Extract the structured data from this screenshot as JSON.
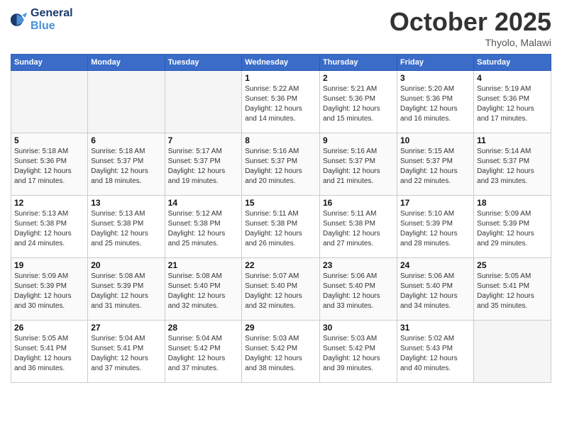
{
  "header": {
    "logo_line1": "General",
    "logo_line2": "Blue",
    "month": "October 2025",
    "location": "Thyolo, Malawi"
  },
  "weekdays": [
    "Sunday",
    "Monday",
    "Tuesday",
    "Wednesday",
    "Thursday",
    "Friday",
    "Saturday"
  ],
  "weeks": [
    [
      {
        "day": "",
        "info": ""
      },
      {
        "day": "",
        "info": ""
      },
      {
        "day": "",
        "info": ""
      },
      {
        "day": "1",
        "info": "Sunrise: 5:22 AM\nSunset: 5:36 PM\nDaylight: 12 hours\nand 14 minutes."
      },
      {
        "day": "2",
        "info": "Sunrise: 5:21 AM\nSunset: 5:36 PM\nDaylight: 12 hours\nand 15 minutes."
      },
      {
        "day": "3",
        "info": "Sunrise: 5:20 AM\nSunset: 5:36 PM\nDaylight: 12 hours\nand 16 minutes."
      },
      {
        "day": "4",
        "info": "Sunrise: 5:19 AM\nSunset: 5:36 PM\nDaylight: 12 hours\nand 17 minutes."
      }
    ],
    [
      {
        "day": "5",
        "info": "Sunrise: 5:18 AM\nSunset: 5:36 PM\nDaylight: 12 hours\nand 17 minutes."
      },
      {
        "day": "6",
        "info": "Sunrise: 5:18 AM\nSunset: 5:37 PM\nDaylight: 12 hours\nand 18 minutes."
      },
      {
        "day": "7",
        "info": "Sunrise: 5:17 AM\nSunset: 5:37 PM\nDaylight: 12 hours\nand 19 minutes."
      },
      {
        "day": "8",
        "info": "Sunrise: 5:16 AM\nSunset: 5:37 PM\nDaylight: 12 hours\nand 20 minutes."
      },
      {
        "day": "9",
        "info": "Sunrise: 5:16 AM\nSunset: 5:37 PM\nDaylight: 12 hours\nand 21 minutes."
      },
      {
        "day": "10",
        "info": "Sunrise: 5:15 AM\nSunset: 5:37 PM\nDaylight: 12 hours\nand 22 minutes."
      },
      {
        "day": "11",
        "info": "Sunrise: 5:14 AM\nSunset: 5:37 PM\nDaylight: 12 hours\nand 23 minutes."
      }
    ],
    [
      {
        "day": "12",
        "info": "Sunrise: 5:13 AM\nSunset: 5:38 PM\nDaylight: 12 hours\nand 24 minutes."
      },
      {
        "day": "13",
        "info": "Sunrise: 5:13 AM\nSunset: 5:38 PM\nDaylight: 12 hours\nand 25 minutes."
      },
      {
        "day": "14",
        "info": "Sunrise: 5:12 AM\nSunset: 5:38 PM\nDaylight: 12 hours\nand 25 minutes."
      },
      {
        "day": "15",
        "info": "Sunrise: 5:11 AM\nSunset: 5:38 PM\nDaylight: 12 hours\nand 26 minutes."
      },
      {
        "day": "16",
        "info": "Sunrise: 5:11 AM\nSunset: 5:38 PM\nDaylight: 12 hours\nand 27 minutes."
      },
      {
        "day": "17",
        "info": "Sunrise: 5:10 AM\nSunset: 5:39 PM\nDaylight: 12 hours\nand 28 minutes."
      },
      {
        "day": "18",
        "info": "Sunrise: 5:09 AM\nSunset: 5:39 PM\nDaylight: 12 hours\nand 29 minutes."
      }
    ],
    [
      {
        "day": "19",
        "info": "Sunrise: 5:09 AM\nSunset: 5:39 PM\nDaylight: 12 hours\nand 30 minutes."
      },
      {
        "day": "20",
        "info": "Sunrise: 5:08 AM\nSunset: 5:39 PM\nDaylight: 12 hours\nand 31 minutes."
      },
      {
        "day": "21",
        "info": "Sunrise: 5:08 AM\nSunset: 5:40 PM\nDaylight: 12 hours\nand 32 minutes."
      },
      {
        "day": "22",
        "info": "Sunrise: 5:07 AM\nSunset: 5:40 PM\nDaylight: 12 hours\nand 32 minutes."
      },
      {
        "day": "23",
        "info": "Sunrise: 5:06 AM\nSunset: 5:40 PM\nDaylight: 12 hours\nand 33 minutes."
      },
      {
        "day": "24",
        "info": "Sunrise: 5:06 AM\nSunset: 5:40 PM\nDaylight: 12 hours\nand 34 minutes."
      },
      {
        "day": "25",
        "info": "Sunrise: 5:05 AM\nSunset: 5:41 PM\nDaylight: 12 hours\nand 35 minutes."
      }
    ],
    [
      {
        "day": "26",
        "info": "Sunrise: 5:05 AM\nSunset: 5:41 PM\nDaylight: 12 hours\nand 36 minutes."
      },
      {
        "day": "27",
        "info": "Sunrise: 5:04 AM\nSunset: 5:41 PM\nDaylight: 12 hours\nand 37 minutes."
      },
      {
        "day": "28",
        "info": "Sunrise: 5:04 AM\nSunset: 5:42 PM\nDaylight: 12 hours\nand 37 minutes."
      },
      {
        "day": "29",
        "info": "Sunrise: 5:03 AM\nSunset: 5:42 PM\nDaylight: 12 hours\nand 38 minutes."
      },
      {
        "day": "30",
        "info": "Sunrise: 5:03 AM\nSunset: 5:42 PM\nDaylight: 12 hours\nand 39 minutes."
      },
      {
        "day": "31",
        "info": "Sunrise: 5:02 AM\nSunset: 5:43 PM\nDaylight: 12 hours\nand 40 minutes."
      },
      {
        "day": "",
        "info": ""
      }
    ]
  ]
}
